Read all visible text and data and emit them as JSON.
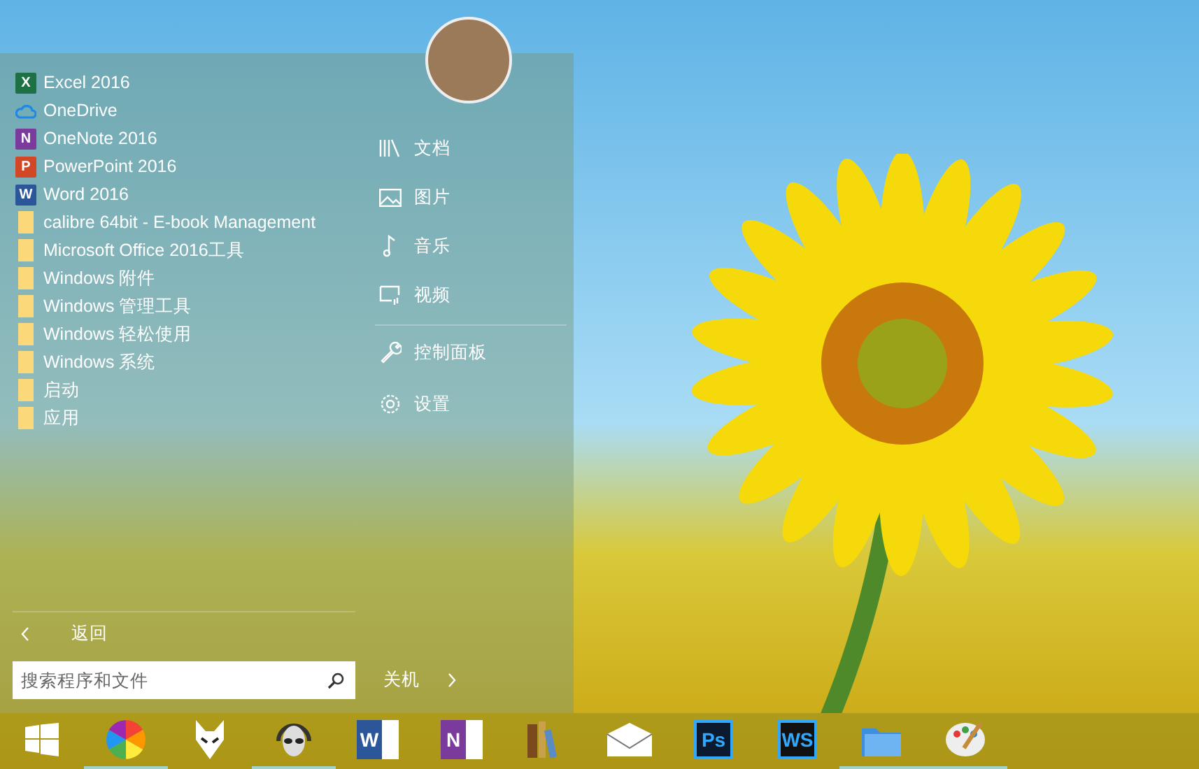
{
  "start_menu": {
    "programs": [
      {
        "label": "Excel 2016",
        "kind": "app",
        "glyph": "X",
        "color": "#1e7145"
      },
      {
        "label": "OneDrive",
        "kind": "cloud",
        "color": "#1e88e5"
      },
      {
        "label": "OneNote 2016",
        "kind": "app",
        "glyph": "N",
        "color": "#7a3b9c"
      },
      {
        "label": "PowerPoint 2016",
        "kind": "app",
        "glyph": "P",
        "color": "#d24726"
      },
      {
        "label": "Word 2016",
        "kind": "app",
        "glyph": "W",
        "color": "#2b579a"
      },
      {
        "label": "calibre 64bit - E-book Management",
        "kind": "folder"
      },
      {
        "label": "Microsoft Office 2016工具",
        "kind": "folder"
      },
      {
        "label": "Windows 附件",
        "kind": "folder"
      },
      {
        "label": "Windows 管理工具",
        "kind": "folder"
      },
      {
        "label": "Windows 轻松使用",
        "kind": "folder"
      },
      {
        "label": "Windows 系统",
        "kind": "folder"
      },
      {
        "label": "启动",
        "kind": "folder"
      },
      {
        "label": "应用",
        "kind": "folder"
      }
    ],
    "places": [
      {
        "label": "文档",
        "kind": "library",
        "divider_before": false
      },
      {
        "label": "图片",
        "kind": "picture",
        "divider_before": false
      },
      {
        "label": "音乐",
        "kind": "music",
        "divider_before": false
      },
      {
        "label": "视频",
        "kind": "video",
        "divider_before": false
      },
      {
        "label": "控制面板",
        "kind": "wrench",
        "divider_before": true
      },
      {
        "label": "设置",
        "kind": "gear",
        "divider_before": false
      }
    ],
    "back": {
      "label": "返回"
    },
    "search": {
      "placeholder": "搜索程序和文件"
    },
    "shutdown": {
      "label": "关机"
    }
  },
  "taskbar": {
    "items": [
      {
        "kind": "windows",
        "running": false
      },
      {
        "kind": "pinwheel",
        "running": true
      },
      {
        "kind": "fox",
        "running": false
      },
      {
        "kind": "alien",
        "running": true
      },
      {
        "kind": "doc",
        "glyph": "W",
        "color": "#2b579a",
        "running": false
      },
      {
        "kind": "doc",
        "glyph": "N",
        "color": "#7a3b9c",
        "running": false
      },
      {
        "kind": "books",
        "running": false
      },
      {
        "kind": "mail",
        "running": false
      },
      {
        "kind": "tile",
        "glyph": "Ps",
        "color": "#0b1a2e",
        "running": false
      },
      {
        "kind": "tile",
        "glyph": "WS",
        "color": "#111111",
        "running": false
      },
      {
        "kind": "folder",
        "running": true
      },
      {
        "kind": "palette",
        "running": true
      }
    ]
  }
}
